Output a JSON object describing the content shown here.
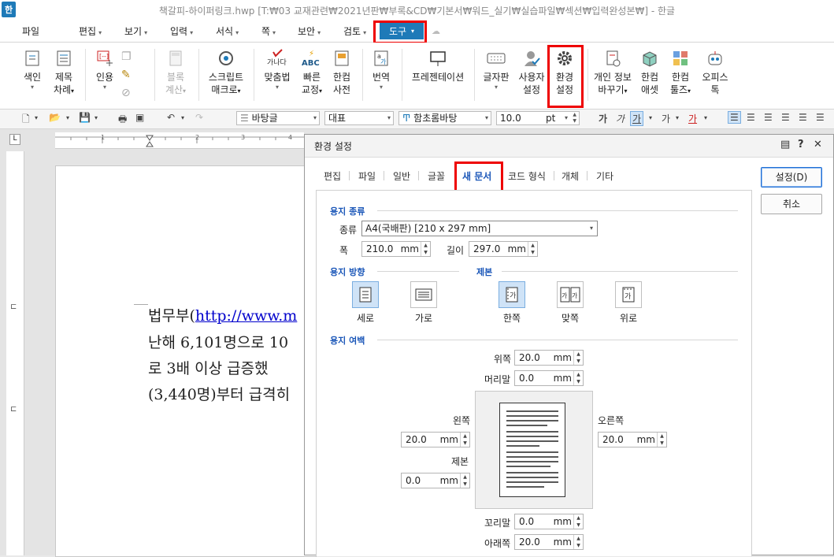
{
  "window": {
    "title": "책갈피-하이퍼링크.hwp [T:₩03 교재관련₩2021년판₩부록&CD₩기본서₩워드_실기₩실습파일₩섹션₩입력완성본₩] - 한글",
    "app_icon": "한"
  },
  "menu": {
    "items": [
      "파일",
      "편집",
      "보기",
      "입력",
      "서식",
      "쪽",
      "보안",
      "검토"
    ],
    "active": "도구"
  },
  "ribbon": {
    "buttons": [
      {
        "l1": "색인",
        "l2": ""
      },
      {
        "l1": "제목",
        "l2": "차례"
      },
      {
        "l1": "인용",
        "l2": ""
      },
      {
        "l1": "블록",
        "l2": "계산"
      },
      {
        "l1": "스크립트",
        "l2": "매크로"
      },
      {
        "l1": "맞춤법",
        "l2": ""
      },
      {
        "l1": "빠른",
        "l2": "교정"
      },
      {
        "l1": "한컴",
        "l2": "사전"
      },
      {
        "l1": "번역",
        "l2": ""
      },
      {
        "l1": "프레젠테이션",
        "l2": ""
      },
      {
        "l1": "글자판",
        "l2": ""
      },
      {
        "l1": "사용자",
        "l2": "설정"
      },
      {
        "l1": "환경",
        "l2": "설정"
      },
      {
        "l1": "개인 정보",
        "l2": "바꾸기"
      },
      {
        "l1": "한컴",
        "l2": "애셋"
      },
      {
        "l1": "한컴",
        "l2": "툴즈"
      },
      {
        "l1": "오피스",
        "l2": "톡"
      }
    ],
    "icon_text": {
      "spell": "가나다",
      "abc": "ABC"
    }
  },
  "format_bar": {
    "style": "바탕글",
    "language": "대표",
    "font": "함초롬바탕",
    "size": "10.0",
    "size_unit": "pt",
    "char_buttons": [
      "가",
      "가",
      "가",
      "가",
      "가"
    ]
  },
  "document": {
    "line1_prefix": "법무부(",
    "line1_link": "http://www.m",
    "line2": "난해 6,101명으로 10",
    "line3": "로 3배 이상 급증했",
    "line4": "(3,440명)부터 급격히",
    "ruler_marks": [
      "1",
      "2",
      "3",
      "4"
    ]
  },
  "dialog": {
    "title": "환경 설정",
    "help": "?",
    "tabs": [
      "편집",
      "파일",
      "일반",
      "글꼴",
      "새 문서",
      "코드 형식",
      "개체",
      "기타"
    ],
    "active_tab": "새 문서",
    "buttons": {
      "ok": "설정(D)",
      "cancel": "취소"
    },
    "paper_type": {
      "section": "용지 종류",
      "type_label": "종류",
      "type_value": "A4(국배판) [210 x 297 mm]",
      "width_label": "폭",
      "width": "210.0",
      "length_label": "길이",
      "length": "297.0",
      "unit": "mm"
    },
    "orientation": {
      "section": "용지 방향",
      "portrait": "세로",
      "landscape": "가로"
    },
    "binding": {
      "section": "제본",
      "single": "한쪽",
      "facing": "맞쪽",
      "top": "위로",
      "icon_char": "가"
    },
    "margins": {
      "section": "용지 여백",
      "top_label": "위쪽",
      "top": "20.0",
      "header_label": "머리말",
      "header": "0.0",
      "left_label": "왼쪽",
      "left": "20.0",
      "right_label": "오른쪽",
      "right": "20.0",
      "gutter_label": "제본",
      "gutter": "0.0",
      "footer_label": "꼬리말",
      "footer": "0.0",
      "bottom_label": "아래쪽",
      "bottom": "20.0",
      "unit": "mm"
    }
  },
  "colors": {
    "accent": "#1e7ab8",
    "highlight_box": "#e00000",
    "tab_active": "#1a56b8"
  }
}
